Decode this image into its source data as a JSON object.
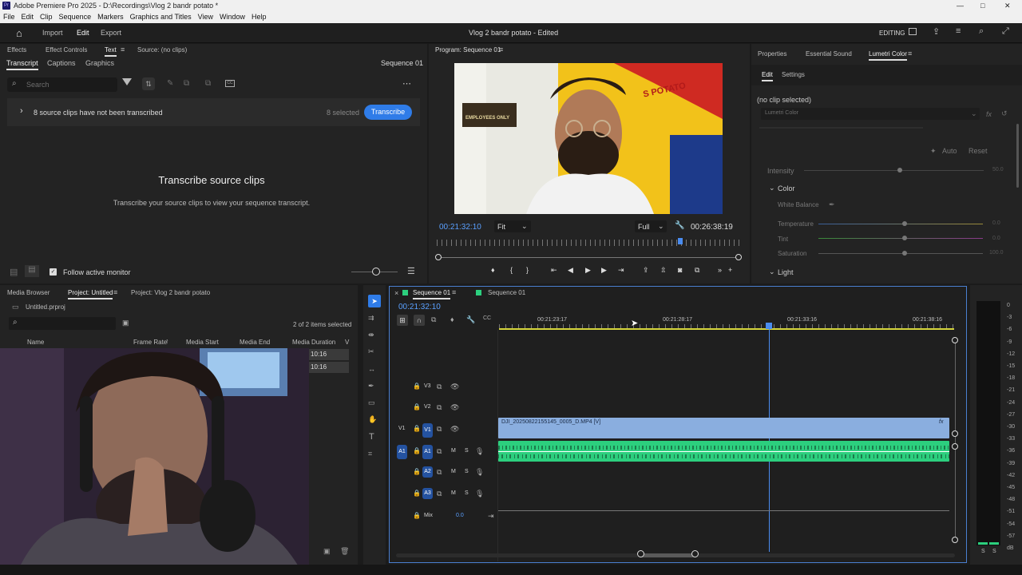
{
  "window": {
    "title": "Adobe Premiere Pro 2025 - D:\\Recordings\\Vlog 2 bandr potato *"
  },
  "menu": [
    "File",
    "Edit",
    "Clip",
    "Sequence",
    "Markers",
    "Graphics and Titles",
    "View",
    "Window",
    "Help"
  ],
  "appbar": {
    "tabs": [
      "Import",
      "Edit",
      "Export"
    ],
    "project_title": "Vlog 2 bandr potato - Edited",
    "workspace": "EDITING"
  },
  "text_panel": {
    "tabs": [
      "Effects",
      "Effect Controls",
      "Text",
      "Source: (no clips)"
    ],
    "subtabs": [
      "Transcript",
      "Captions",
      "Graphics"
    ],
    "sequence": "Sequence 01",
    "search_placeholder": "Search",
    "notice": "8 source clips have not been transcribed",
    "selected": "8 selected",
    "transcribe_button": "Transcribe",
    "heading": "Transcribe source clips",
    "subtext": "Transcribe your source clips to view your sequence transcript.",
    "follow_label": "Follow active monitor"
  },
  "program": {
    "tab": "Program: Sequence 01",
    "timecode_left": "00:21:32:10",
    "fit": "Fit",
    "quality": "Full",
    "timecode_right": "00:26:38:19",
    "sign_text": "EMPLOYEES ONLY",
    "wall_text": "S POTATO"
  },
  "lumetri": {
    "tabs": [
      "Properties",
      "Essential Sound",
      "Lumetri Color"
    ],
    "subtabs": [
      "Edit",
      "Settings"
    ],
    "no_clip": "(no clip selected)",
    "dropdown": "Lumetri Color",
    "auto": "Auto",
    "reset": "Reset",
    "intensity": {
      "label": "Intensity",
      "value": "50.0"
    },
    "color_section": "Color",
    "white_balance": "White Balance",
    "sliders": [
      {
        "label": "Temperature",
        "value": "0.0"
      },
      {
        "label": "Tint",
        "value": "0.0"
      },
      {
        "label": "Saturation",
        "value": "100.0"
      }
    ],
    "light_section": "Light"
  },
  "project": {
    "tabs": [
      "Media Browser",
      "Project: Untitled",
      "Project: Vlog 2 bandr potato"
    ],
    "file": "Untitled.prproj",
    "count": "2 of 2 items selected",
    "columns": [
      "Name",
      "Frame Rate",
      "Media Start",
      "Media End",
      "Media Duration",
      "V"
    ],
    "durations": [
      "10:16",
      "10:16"
    ]
  },
  "timeline": {
    "tabs": [
      "Sequence 01",
      "Sequence 01"
    ],
    "timecode": "00:21:32:10",
    "ruler": [
      "00:21:23:17",
      "00:21:28:17",
      "00:21:33:16",
      "00:21:38:16"
    ],
    "video_tracks": [
      "V3",
      "V2",
      "V1"
    ],
    "audio_tracks": [
      "A1",
      "A2",
      "A3"
    ],
    "src_v": "V1",
    "src_a": "A1",
    "clip_name": "DJI_20250822155145_0005_D.MP4 [V]",
    "mix_label": "Mix",
    "mix_value": "0.0",
    "m": "M",
    "s": "S"
  },
  "meter": {
    "labels": [
      "0",
      "-3",
      "-6",
      "-9",
      "-12",
      "-15",
      "-18",
      "-21",
      "-24",
      "-27",
      "-30",
      "-33",
      "-36",
      "-39",
      "-42",
      "-45",
      "-48",
      "-51",
      "-54",
      "-57",
      "dB"
    ],
    "bottom": [
      "S",
      "S"
    ]
  },
  "colors": {
    "accent": "#2f7ce8",
    "audio_clip": "#2ccf7e",
    "video_clip": "#8aaedf",
    "playhead": "#4a8cf0"
  }
}
